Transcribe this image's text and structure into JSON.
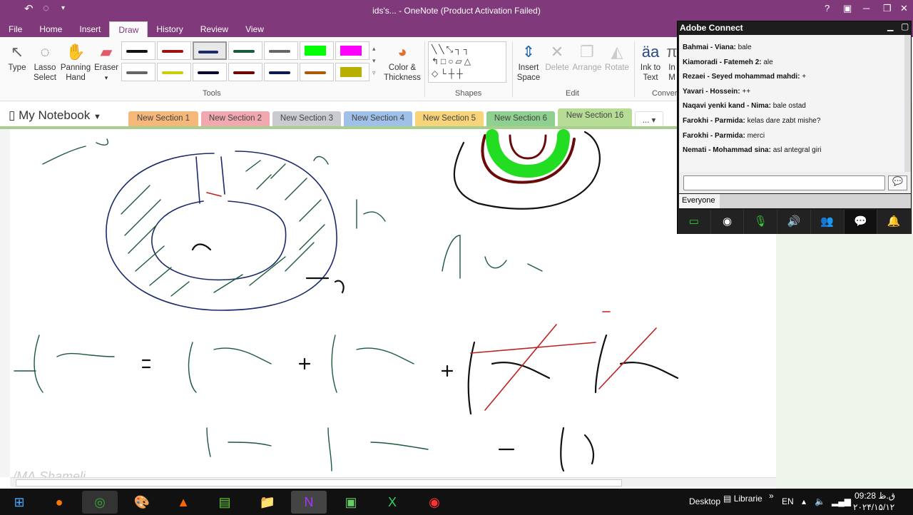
{
  "window": {
    "title": "ids's... - OneNote (Product Activation Failed)"
  },
  "menu_tabs": [
    "File",
    "Home",
    "Insert",
    "Draw",
    "History",
    "Review",
    "View"
  ],
  "ribbon": {
    "type": "Type",
    "lasso": "Lasso Select",
    "panning": "Panning Hand",
    "eraser": "Eraser",
    "color_thickness": "Color & Thickness",
    "insert_space": "Insert Space",
    "delete": "Delete",
    "arrange": "Arrange",
    "rotate": "Rotate",
    "ink_to_text": "Ink to Text",
    "ink_to_math": "In M",
    "groups": {
      "tools": "Tools",
      "shapes": "Shapes",
      "edit": "Edit",
      "convert": "Conver"
    },
    "pen_colors": [
      "#111111",
      "#a01010",
      "#1a2a6c",
      "#1a5a3a",
      "#666666",
      "#00ff00",
      "#ff00ff",
      "#666666",
      "#cccc00",
      "#0a0a30",
      "#700000",
      "#0a1a50",
      "#b05a00",
      "#b8b000"
    ]
  },
  "notebook": {
    "name": "My Notebook",
    "sections": [
      "New Section 1",
      "New Section 2",
      "New Section 3",
      "New Section 4",
      "New Section 5",
      "New Section 6",
      "New Section 16"
    ],
    "more": "..."
  },
  "watermark": "/MA.Shameli",
  "chat": {
    "title": "Adobe Connect",
    "audience": "Everyone",
    "messages": [
      {
        "name": "Bahmai - Viana:",
        "text": "bale"
      },
      {
        "name": "Kiamoradi - Fatemeh 2:",
        "text": "ale"
      },
      {
        "name": "Rezaei - Seyed mohammad mahdi:",
        "text": "+"
      },
      {
        "name": "Yavari - Hossein:",
        "text": "++"
      },
      {
        "name": "Naqavi yenki kand - Nima:",
        "text": "bale ostad"
      },
      {
        "name": "Farokhi - Parmida:",
        "text": "kelas dare zabt mishe?"
      },
      {
        "name": "Farokhi - Parmida:",
        "text": "merci"
      },
      {
        "name": "Nemati - Mohammad sina:",
        "text": "asl antegral giri"
      }
    ]
  },
  "taskbar": {
    "desktop": "Desktop",
    "libraries": "Librarie",
    "lang": "EN",
    "time": "09:28 ق.ظ",
    "date": "۲۰۲۴/۱۵/۱۲"
  }
}
